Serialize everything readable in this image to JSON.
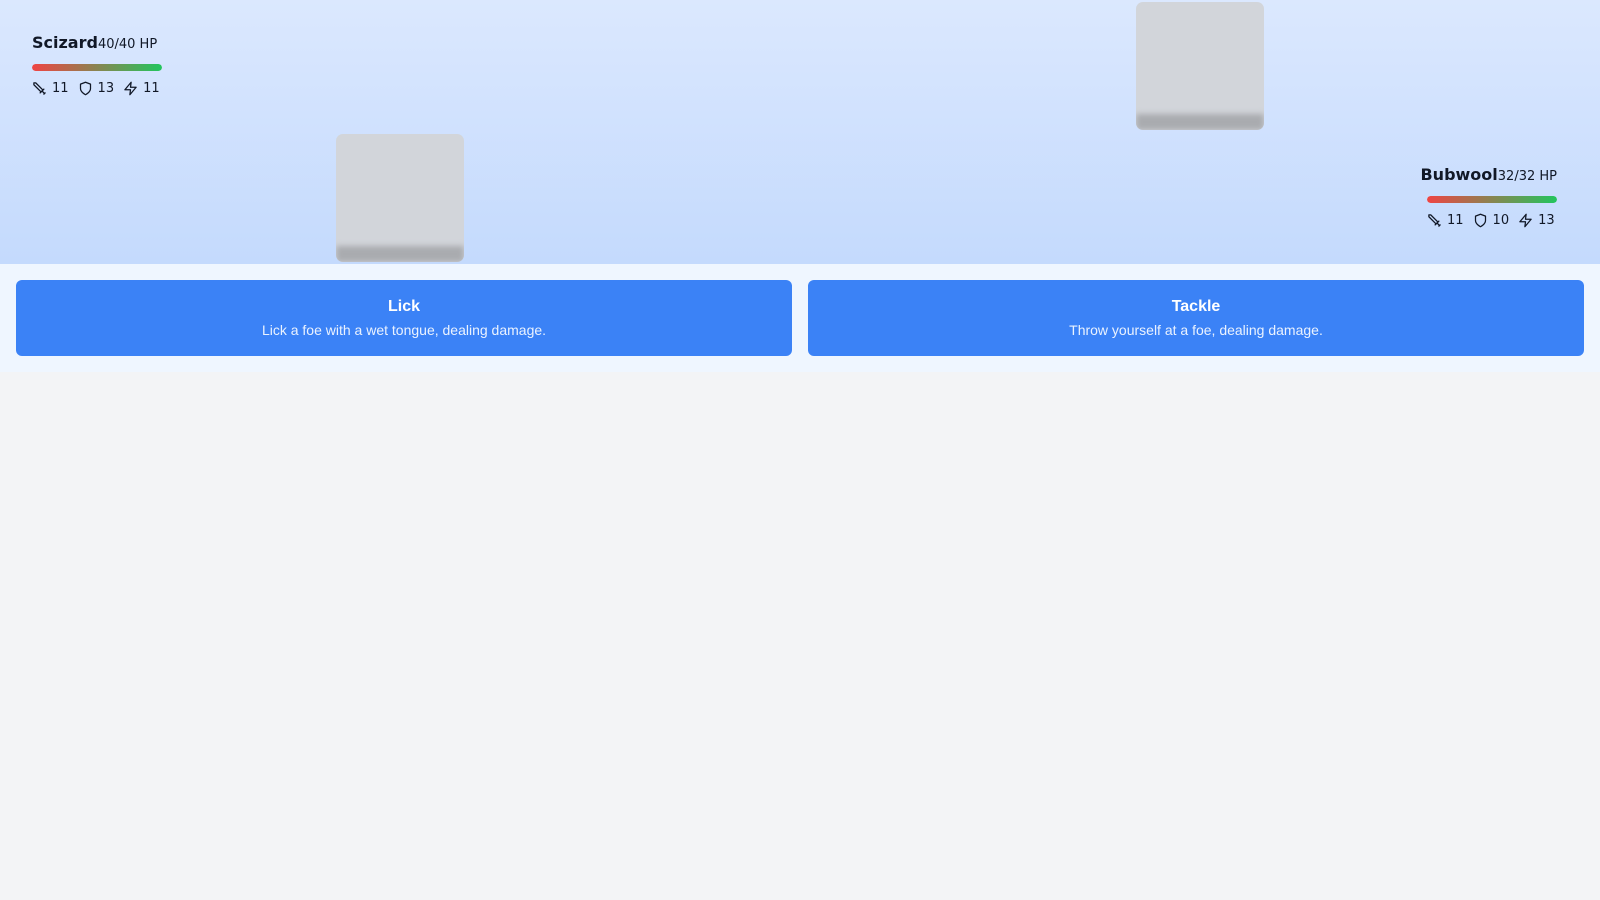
{
  "enemy": {
    "name": "Scizard",
    "hp_text": "40/40 HP",
    "hp_fraction": 1.0,
    "stats": {
      "attack": "11",
      "defense": "13",
      "speed": "11"
    },
    "sprite_icon": "enemy-sprite-placeholder"
  },
  "player": {
    "name": "Bubwool",
    "hp_text": "32/32 HP",
    "hp_fraction": 1.0,
    "stats": {
      "attack": "11",
      "defense": "10",
      "speed": "13"
    },
    "sprite_icon": "player-sprite-placeholder"
  },
  "moves": [
    {
      "name": "Lick",
      "description": "Lick a foe with a wet tongue, dealing damage."
    },
    {
      "name": "Tackle",
      "description": "Throw yourself at a foe, dealing damage."
    }
  ],
  "icons": {
    "attack": "sword-icon",
    "defense": "shield-icon",
    "speed": "lightning-icon"
  },
  "colors": {
    "arena_top": "#dbe8fe",
    "arena_bottom": "#c4dafd",
    "move_button": "#3b82f6",
    "hp_low": "#ef4444",
    "hp_high": "#22c55e"
  }
}
